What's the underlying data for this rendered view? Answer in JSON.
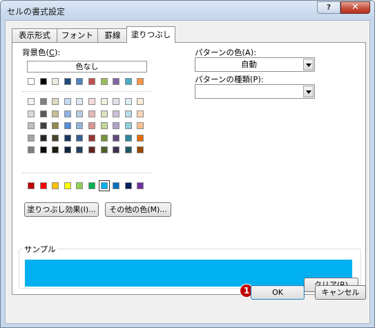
{
  "window": {
    "title": "セルの書式設定",
    "help_label": "?",
    "close_label": "✕"
  },
  "tabs": [
    {
      "label": "表示形式"
    },
    {
      "label": "フォント"
    },
    {
      "label": "罫線"
    },
    {
      "label": "塗りつぶし",
      "active": true
    }
  ],
  "fill": {
    "bg_label": "背景色(",
    "bg_key": "C",
    "bg_suffix": "):",
    "no_color_label": "色なし",
    "selected_color": "#00b0f0",
    "standard_row": [
      "#ffffff",
      "#000000",
      "#eeece1",
      "#1f497d",
      "#4f81bd",
      "#c0504d",
      "#9bbb59",
      "#8064a2",
      "#4bacc6",
      "#f79646"
    ],
    "tint_rows": [
      [
        "#f2f2f2",
        "#808080",
        "#ddd9c3",
        "#c6d9f1",
        "#dbe5f1",
        "#f2dcdb",
        "#ebf1dd",
        "#e5e0ec",
        "#dbeef3",
        "#fdeada"
      ],
      [
        "#d9d9d9",
        "#595959",
        "#c4bd97",
        "#8db3e2",
        "#b8cce4",
        "#e5b9b7",
        "#d7e3bc",
        "#ccc1d9",
        "#b7dde8",
        "#fbd5b5"
      ],
      [
        "#bfbfbf",
        "#404040",
        "#938953",
        "#548dd4",
        "#95b3d7",
        "#d99694",
        "#c3d69b",
        "#b2a2c7",
        "#92cddc",
        "#fac08f"
      ],
      [
        "#a6a6a6",
        "#262626",
        "#494429",
        "#17365d",
        "#366092",
        "#953734",
        "#76923c",
        "#5f497a",
        "#31859b",
        "#e36c09"
      ],
      [
        "#7f7f7f",
        "#0c0c0c",
        "#1d1b10",
        "#0f243e",
        "#244061",
        "#632423",
        "#4f6128",
        "#3f3151",
        "#205867",
        "#974806"
      ]
    ],
    "accent_row": [
      "#c00000",
      "#ff0000",
      "#ffc000",
      "#ffff00",
      "#92d050",
      "#00b050",
      "#00b0f0",
      "#0070c0",
      "#002060",
      "#7030a0"
    ],
    "fill_effects_button": "塗りつぶし効果(I)...",
    "more_colors_button": "その他の色(M)...",
    "pattern_color_label": "パターンの色(A):",
    "pattern_color_value": "自動",
    "pattern_style_label": "パターンの種類(P):",
    "pattern_style_value": ""
  },
  "sample": {
    "label": "サンプル"
  },
  "clear_button": "クリア(R)",
  "footer": {
    "badge": "1",
    "ok_label": "OK",
    "cancel_label": "キャンセル"
  }
}
